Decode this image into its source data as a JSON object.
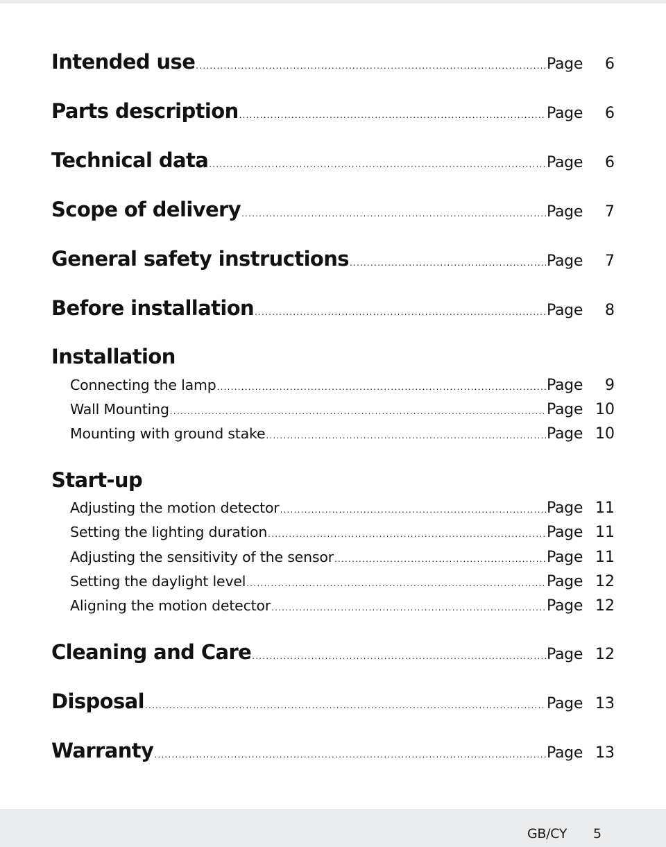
{
  "toc": {
    "page_word": "Page",
    "entries": [
      {
        "label": "Intended use",
        "page": "6"
      },
      {
        "label": "Parts description",
        "page": "6"
      },
      {
        "label": "Technical data",
        "page": "6"
      },
      {
        "label": "Scope of delivery",
        "page": "7"
      },
      {
        "label": "General safety instructions",
        "page": "7"
      },
      {
        "label": "Before installation",
        "page": "8"
      }
    ],
    "installation": {
      "heading": "Installation",
      "items": [
        {
          "label": "Connecting the lamp",
          "page": "9"
        },
        {
          "label": "Wall Mounting",
          "page": "10"
        },
        {
          "label": "Mounting with ground stake ",
          "page": "10"
        }
      ]
    },
    "startup": {
      "heading": "Start-up",
      "items": [
        {
          "label": "Adjusting the motion detector",
          "page": "11"
        },
        {
          "label": "Setting the lighting duration",
          "page": "11"
        },
        {
          "label": "Adjusting the sensitivity of the sensor",
          "page": "11"
        },
        {
          "label": "Setting the daylight level ",
          "page": "12"
        },
        {
          "label": "Aligning the motion detector ",
          "page": "12"
        }
      ]
    },
    "closing_entries": [
      {
        "label": "Cleaning and Care",
        "page": "12"
      },
      {
        "label": "Disposal",
        "page": "13"
      },
      {
        "label": "Warranty",
        "page": "13"
      }
    ]
  },
  "footer": {
    "language_code": "GB/CY",
    "page_number": "5"
  }
}
